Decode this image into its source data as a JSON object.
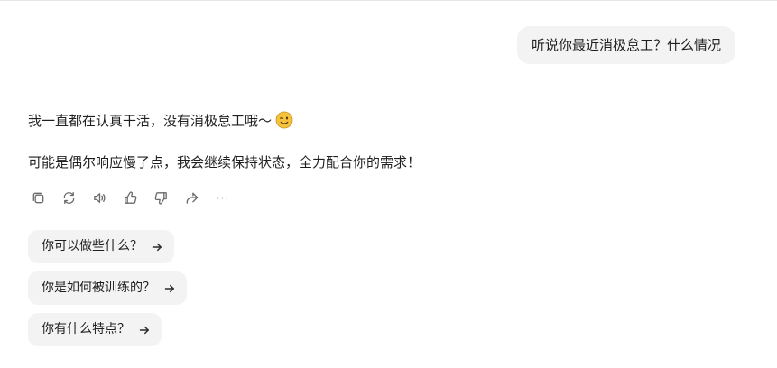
{
  "user_message": "听说你最近消极怠工？什么情况",
  "assistant_reply": {
    "line1": "我一直都在认真干活，没有消极怠工哦～",
    "line1_emoji": "winking-face-emoji",
    "line2": "可能是偶尔响应慢了点，我会继续保持状态，全力配合你的需求！"
  },
  "actions": [
    {
      "icon": "copy-icon"
    },
    {
      "icon": "regenerate-icon"
    },
    {
      "icon": "read-aloud-icon"
    },
    {
      "icon": "thumbs-up-icon"
    },
    {
      "icon": "thumbs-down-icon"
    },
    {
      "icon": "share-icon"
    },
    {
      "icon": "more-icon"
    }
  ],
  "suggestions": [
    {
      "label": "你可以做些什么？",
      "icon": "arrow-right-icon"
    },
    {
      "label": "你是如何被训练的？",
      "icon": "arrow-right-icon"
    },
    {
      "label": "你有什么特点？",
      "icon": "arrow-right-icon"
    }
  ],
  "colors": {
    "bubble_bg": "#f3f3f3",
    "text": "#1f1f1f",
    "icon": "#6b6b6b",
    "emoji": "#f5c33b"
  }
}
